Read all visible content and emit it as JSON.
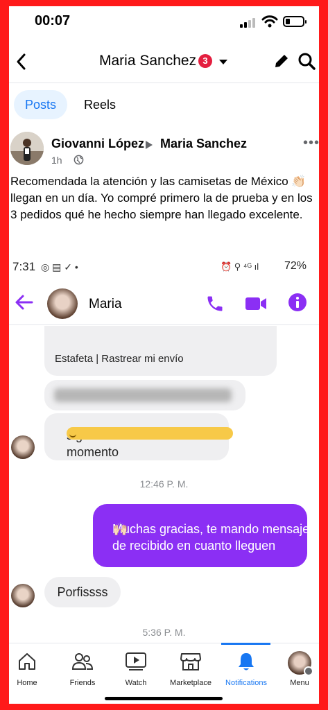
{
  "status_bar": {
    "time": "00:07"
  },
  "header": {
    "title": "Maria Sanchez",
    "badge_count": "3"
  },
  "tabs": [
    {
      "label": "Posts",
      "active": true
    },
    {
      "label": "Reels",
      "active": false
    }
  ],
  "post": {
    "author": "Giovanni López",
    "target": "Maria Sanchez",
    "time": "1h",
    "text_before_emoji": "Recomendada la atención y las camisetas de México",
    "emoji": "👏🏻",
    "text_after_emoji": "llegan en un día. Yo compré primero la de prueba y en los 3 pedidos qué he hecho siempre han llegado excelente."
  },
  "embedded_screenshot": {
    "status_bar": {
      "time": "7:31",
      "battery": "72%"
    },
    "chat_header": {
      "name": "Maria"
    },
    "messages": [
      {
        "text": "Estafeta | Rastrear mi envío",
        "direction": "incoming"
      },
      {
        "text": "sigo monitoreando en todo momento",
        "direction": "incoming"
      },
      {
        "timestamp": "12:46 P. M."
      },
      {
        "text": "Muchas gracias, te mando mensaje de recibido en cuanto lleguen",
        "direction": "outgoing"
      },
      {
        "text": "Porfissss",
        "direction": "incoming"
      },
      {
        "timestamp": "5:36 P. M."
      }
    ]
  },
  "bottom_nav": [
    {
      "label": "Home",
      "icon": "home-icon"
    },
    {
      "label": "Friends",
      "icon": "friends-icon"
    },
    {
      "label": "Watch",
      "icon": "watch-icon"
    },
    {
      "label": "Marketplace",
      "icon": "marketplace-icon"
    },
    {
      "label": "Notifications",
      "icon": "bell-icon",
      "active": true
    },
    {
      "label": "Menu",
      "icon": "menu-avatar"
    }
  ],
  "colors": {
    "accent": "#1877f2",
    "messenger_purple": "#8b2ff4",
    "badge": "#e41e3f",
    "frame": "#ff1a1a"
  }
}
